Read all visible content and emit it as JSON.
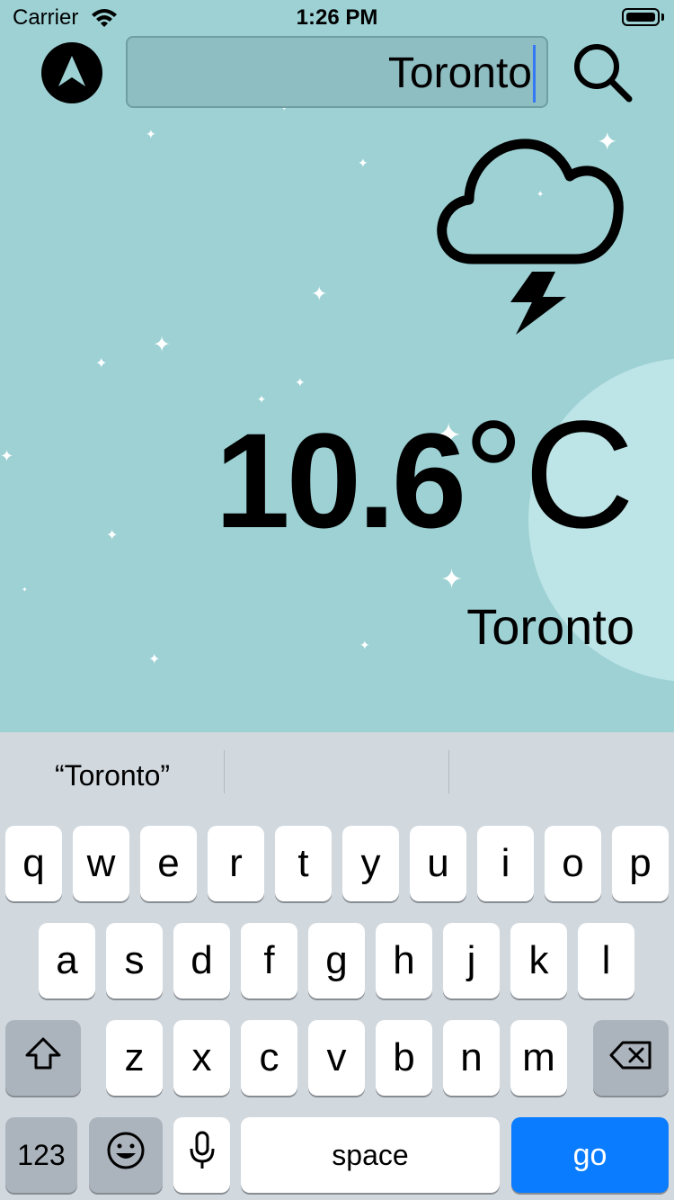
{
  "status_bar": {
    "carrier": "Carrier",
    "time": "1:26 PM"
  },
  "search": {
    "value": "Toronto"
  },
  "weather": {
    "temperature": "10.6",
    "unit": "°C",
    "city": "Toronto",
    "condition_icon": "cloud-lightning-icon"
  },
  "keyboard": {
    "suggestions": [
      "“Toronto”",
      "",
      ""
    ],
    "row1": [
      "q",
      "w",
      "e",
      "r",
      "t",
      "y",
      "u",
      "i",
      "o",
      "p"
    ],
    "row2": [
      "a",
      "s",
      "d",
      "f",
      "g",
      "h",
      "j",
      "k",
      "l"
    ],
    "row3": [
      "z",
      "x",
      "c",
      "v",
      "b",
      "n",
      "m"
    ],
    "numbers_label": "123",
    "space_label": "space",
    "go_label": "go"
  },
  "colors": {
    "background": "#9dd1d4",
    "moon": "#bde4e6",
    "keyboard": "#d1d8de",
    "go_key": "#0a7cff",
    "caret": "#3478f6"
  }
}
